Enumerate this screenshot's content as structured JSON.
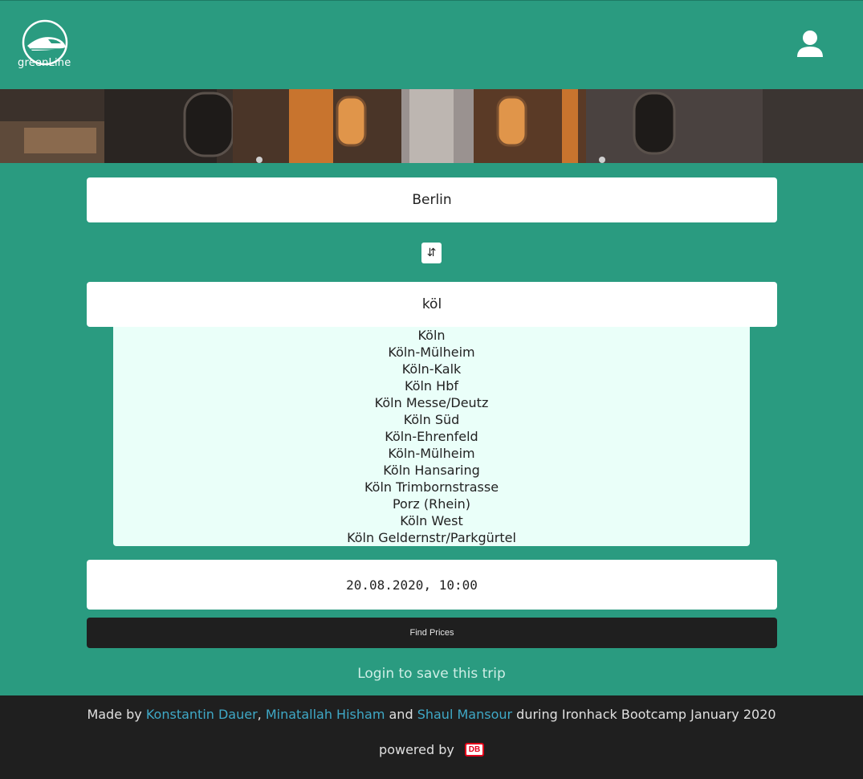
{
  "header": {
    "logo_text": "greenLine",
    "user_icon": "user-icon"
  },
  "search": {
    "from_value": "Berlin",
    "swap_icon": "swap-arrows-icon",
    "swap_glyph": "⇵",
    "to_value": "köl",
    "suggestions": [
      "Köln",
      "Köln-Mülheim",
      "Köln-Kalk",
      "Köln Hbf",
      "Köln Messe/Deutz",
      "Köln Süd",
      "Köln-Ehrenfeld",
      "Köln-Mülheim",
      "Köln Hansaring",
      "Köln Trimbornstrasse",
      "Porz (Rhein)",
      "Köln West",
      "Köln Geldernstr/Parkgürtel"
    ],
    "datetime_value": "20.08.2020, 10:00",
    "find_button": "Find Prices"
  },
  "login_link": "Login to save this trip",
  "footer": {
    "made_by": "Made by",
    "author1": "Konstantin Dauer",
    "sep1": ",",
    "author2": "Minatallah Hisham",
    "and": "and",
    "author3": "Shaul Mansour",
    "during": "during Ironhack Bootcamp January 2020",
    "powered_by": "powered by",
    "db_logo": "DB"
  },
  "colors": {
    "primary": "#2a9b80",
    "dark": "#1f1f1f",
    "link": "#3fa9c7",
    "suggestion_bg": "#eafff9"
  }
}
